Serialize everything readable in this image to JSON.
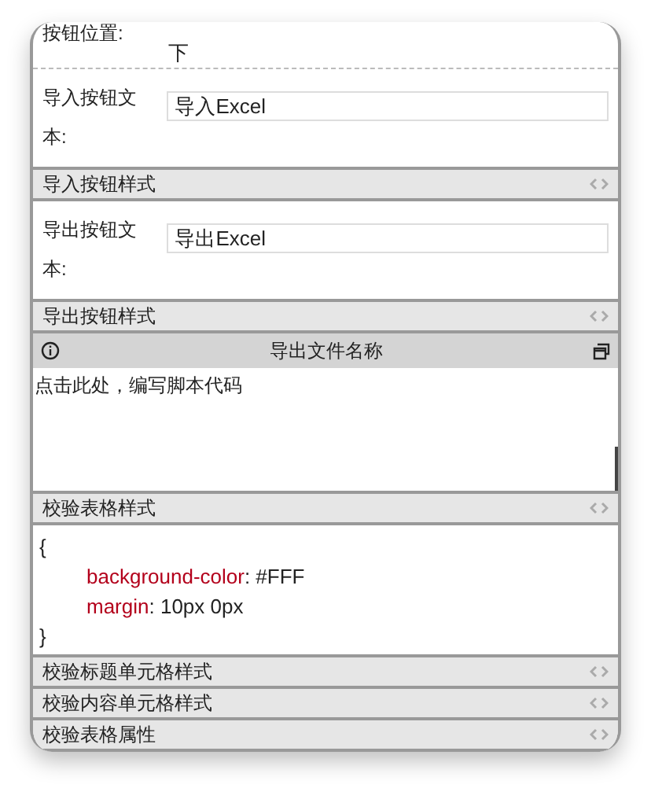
{
  "sections": [
    {
      "kind": "text",
      "label": "按钮位置:",
      "value": "下"
    },
    {
      "kind": "input",
      "label": "导入按钮文本:",
      "value": "导入Excel"
    },
    {
      "kind": "collapsed",
      "title": "导入按钮样式"
    },
    {
      "kind": "input",
      "label": "导出按钮文本:",
      "value": "导出Excel"
    },
    {
      "kind": "collapsed",
      "title": "导出按钮样式"
    },
    {
      "kind": "editor",
      "title": "导出文件名称",
      "placeholder": "点击此处，编写脚本代码"
    },
    {
      "kind": "css",
      "title": "校验表格样式",
      "open": "{",
      "close": "}",
      "lines": [
        {
          "property": "background-color",
          "separator": ":",
          "value": "#FFF"
        },
        {
          "property": "margin",
          "separator": ":",
          "value": "10px 0px"
        }
      ]
    },
    {
      "kind": "collapsed",
      "title": "校验标题单元格样式"
    },
    {
      "kind": "collapsed",
      "title": "校验内容单元格样式"
    },
    {
      "kind": "collapsed",
      "title": "校验表格属性"
    }
  ]
}
